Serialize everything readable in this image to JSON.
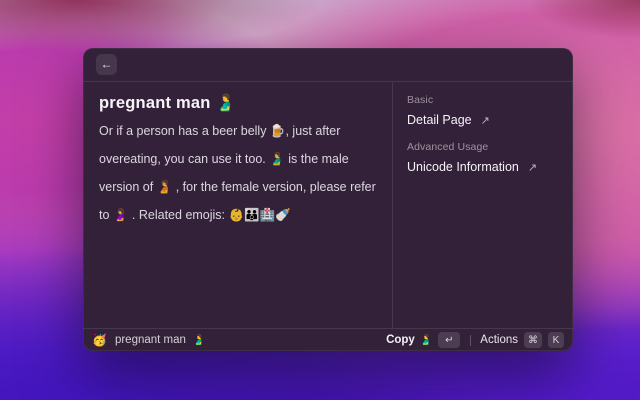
{
  "window": {
    "header": {
      "back_icon": "←"
    },
    "detail": {
      "title": "pregnant man  🫃",
      "description": "Or if a person has a beer belly 🍺, just after overeating, you can use it too. 🫃 is the male version of 🫄 , for the female version, please refer to 🤰 . Related emojis: 👶👪🏥🍼"
    },
    "metadata": {
      "sections": [
        {
          "label": "Basic",
          "link": "Detail Page",
          "icon": "↗"
        },
        {
          "label": "Advanced Usage",
          "link": "Unicode Information",
          "icon": "↗"
        }
      ]
    },
    "footer": {
      "app_icon": "🥳",
      "status_text": "pregnant man",
      "status_emoji": "🫃",
      "primary_action": "Copy",
      "primary_action_emoji": "🫃",
      "primary_key": "↵",
      "actions_label": "Actions",
      "actions_keys": [
        "⌘",
        "K"
      ]
    }
  },
  "colors": {
    "window_tint": "#342139",
    "text_primary": "#f7f4f8",
    "text_secondary": "#9b93a1",
    "wallpaper_pink": "#d05fa8",
    "wallpaper_violet": "#5a1dd6"
  }
}
